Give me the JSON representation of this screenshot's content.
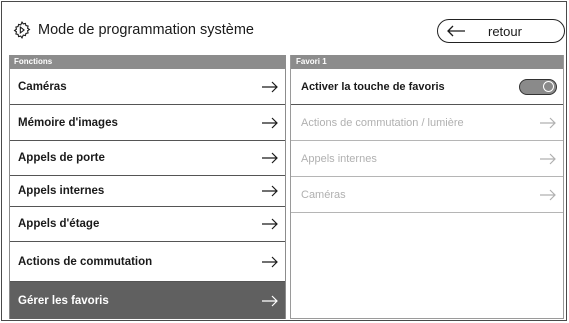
{
  "header": {
    "title": "Mode de programmation système",
    "back_label": "retour"
  },
  "left_panel": {
    "title": "Fonctions",
    "items": [
      {
        "label": "Caméras",
        "active": false
      },
      {
        "label": "Mémoire d'images",
        "active": false
      },
      {
        "label": "Appels de porte",
        "active": false
      },
      {
        "label": "Appels internes",
        "active": false
      },
      {
        "label": "Appels d'étage",
        "active": false
      },
      {
        "label": "Actions de commutation",
        "active": false
      },
      {
        "label": "Gérer les favoris",
        "active": true
      }
    ]
  },
  "right_panel": {
    "title": "Favori 1",
    "toggle_row": {
      "label": "Activer la touche de favoris",
      "state": "off"
    },
    "items": [
      {
        "label": "Actions de commutation / lumière",
        "enabled": false
      },
      {
        "label": "Appels internes",
        "enabled": false
      },
      {
        "label": "Caméras",
        "enabled": false
      }
    ]
  },
  "icons": {
    "settings": "gear-icon",
    "back": "arrow-left-icon",
    "row_arrow": "arrow-right-icon"
  },
  "colors": {
    "header_bar": "#8c8c8c",
    "active_row": "#606060",
    "disabled_text": "#b0b0b0"
  }
}
